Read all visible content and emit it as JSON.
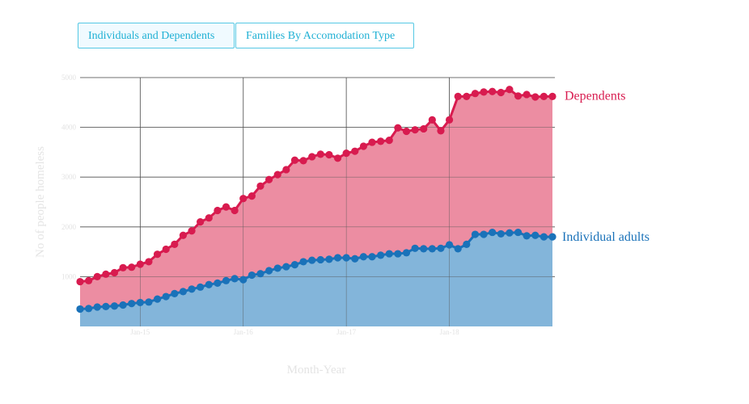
{
  "tabs": [
    {
      "label": "Individuals and Dependents",
      "active": true
    },
    {
      "label": "Families By Accomodation Type",
      "active": false
    }
  ],
  "colors": {
    "dependents_line": "#d81b4f",
    "dependents_area": "#ec8da2",
    "individuals_line": "#1a72b9",
    "individuals_area": "#83b5da",
    "grid": "#555555",
    "tab_text": "#1fb0d4",
    "tab_border": "#55c8e4"
  },
  "chart_data": {
    "type": "area",
    "xlabel": "Month-Year",
    "ylabel": "No of people homeless",
    "ylim": [
      0,
      5000
    ],
    "yticks": [
      1000,
      2000,
      3000,
      4000,
      5000
    ],
    "ytick_labels": [
      "1000",
      "2000",
      "3000",
      "4000",
      "5000"
    ],
    "xticks": [
      {
        "label": "Jan-15",
        "index": 7
      },
      {
        "label": "Jan-16",
        "index": 19
      },
      {
        "label": "Jan-17",
        "index": 31
      },
      {
        "label": "Jan-18",
        "index": 43
      }
    ],
    "x_start": "Jun-14",
    "grid": true,
    "legend": "inline labels at right end of series",
    "series": [
      {
        "name": "Individual adults",
        "values": [
          350,
          360,
          390,
          400,
          410,
          430,
          460,
          480,
          490,
          550,
          600,
          660,
          700,
          750,
          790,
          840,
          870,
          920,
          960,
          940,
          1030,
          1060,
          1120,
          1170,
          1200,
          1240,
          1300,
          1330,
          1340,
          1350,
          1380,
          1380,
          1360,
          1400,
          1400,
          1430,
          1460,
          1460,
          1480,
          1570,
          1560,
          1560,
          1570,
          1640,
          1560,
          1650,
          1850,
          1850,
          1890,
          1860,
          1880,
          1890,
          1820,
          1830,
          1800,
          1800
        ]
      },
      {
        "name": "Dependents",
        "values": [
          900,
          920,
          1000,
          1050,
          1080,
          1180,
          1190,
          1250,
          1300,
          1450,
          1550,
          1650,
          1830,
          1920,
          2100,
          2180,
          2330,
          2400,
          2330,
          2570,
          2620,
          2820,
          2950,
          3050,
          3150,
          3340,
          3330,
          3410,
          3460,
          3450,
          3380,
          3480,
          3520,
          3620,
          3700,
          3720,
          3740,
          3990,
          3920,
          3950,
          3970,
          4150,
          3930,
          4150,
          4620,
          4620,
          4680,
          4710,
          4720,
          4700,
          4760,
          4630,
          4660,
          4610,
          4620,
          4620
        ]
      }
    ]
  }
}
